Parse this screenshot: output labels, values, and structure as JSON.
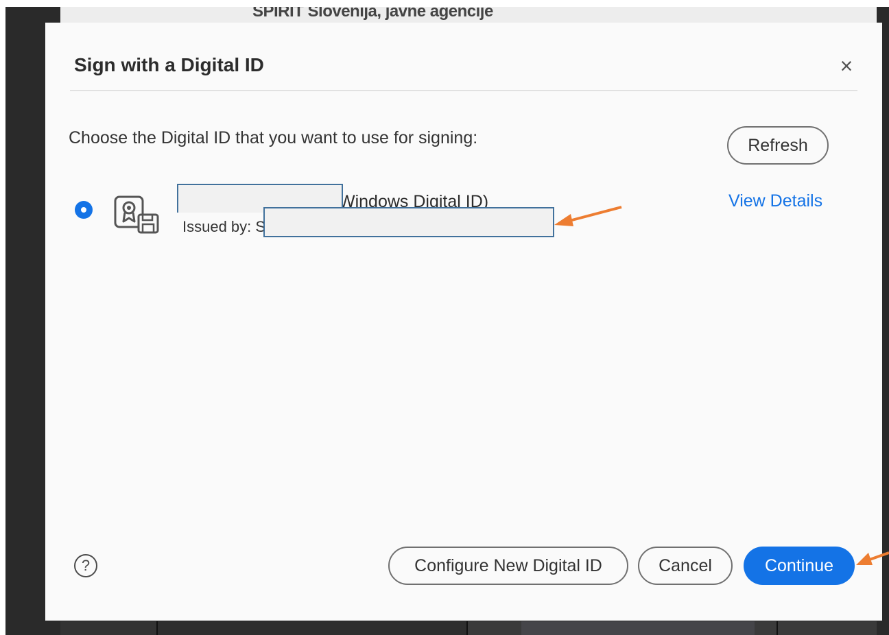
{
  "background": {
    "document_heading": "SPIRIT Slovenija, javne agencije"
  },
  "dialog": {
    "title": "Sign with a Digital ID",
    "close_glyph": "×",
    "prompt": "Choose the Digital ID that you want to use for signing:",
    "refresh_label": "Refresh",
    "digital_id": {
      "selected": true,
      "name_suffix": "Windows Digital ID)",
      "issued_by_prefix": "Issued by: S",
      "view_details_label": "View Details",
      "icon": "certificate-icon"
    },
    "help_glyph": "?",
    "buttons": {
      "configure_label": "Configure New Digital ID",
      "cancel_label": "Cancel",
      "continue_label": "Continue"
    }
  },
  "colors": {
    "accent": "#1473e6",
    "annotation_arrow": "#ed7d31",
    "redaction_border": "#41719c"
  }
}
